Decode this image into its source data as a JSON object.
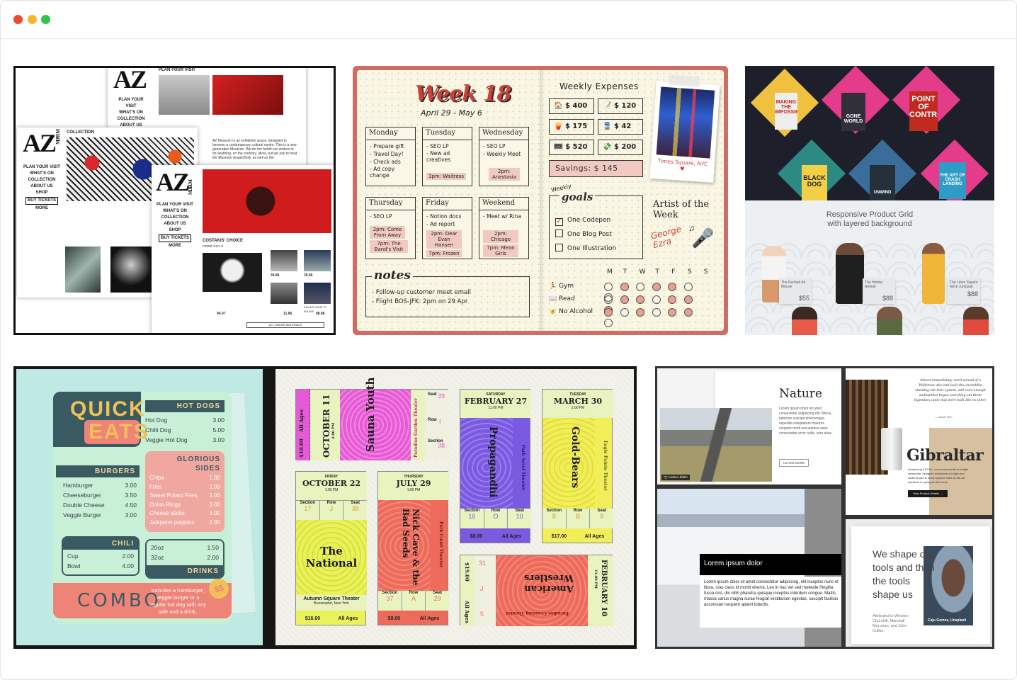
{
  "window": {
    "dot_colors": [
      "#ee4a30",
      "#f6b52c",
      "#2fc44a"
    ]
  },
  "az": {
    "logo": "AZ",
    "logo_sub": "MUSEUM",
    "nav": [
      "PLAN YOUR VISIT",
      "WHAT'S ON",
      "COLLECTION",
      "ABOUT US",
      "SHOP",
      "BUY TICKETS",
      "MORE"
    ],
    "top_heading": "PLAN YOUR VISIT",
    "collection_label": "COLLECTION",
    "body": "AZ Museum is an exhibition space, designed to become a contemporary cultural centre. This is a new generation Museum. We do not forbid our visitors to do anything, on the contrary, allow, but we ask to treat the Museum respectfully, as well as the",
    "choice_title": "COSTAKIS' CHOICE",
    "choice_sub": "FROM JULY 8",
    "prices": [
      "39.86",
      "39.86",
      "94.07",
      "11.86",
      "88.86"
    ],
    "caption": "SALVE PLAGUE TO ENLAND",
    "all_button": "ALL ONLINE MATERIALS"
  },
  "planner": {
    "title": "Week 18",
    "dates": "April 29 - May 6",
    "days": [
      {
        "name": "Monday",
        "items": [
          "- Prepare gift",
          "- Travel Day!",
          "- Check ads",
          "- Ad copy change"
        ],
        "highlight": ""
      },
      {
        "name": "Tuesday",
        "items": [
          "- SEO LP",
          "- New ad creatives"
        ],
        "highlight": "3pm: Waitress"
      },
      {
        "name": "Wednesday",
        "items": [
          "- SEO LP",
          "- Weekly Meet"
        ],
        "highlight": "2pm: Anastasia"
      },
      {
        "name": "Thursday",
        "items": [
          "- SEO LP"
        ],
        "highlight": "2pm: Come From Away",
        "highlight2": "7pm: The Band's Visit"
      },
      {
        "name": "Friday",
        "items": [
          "- Notion docs",
          "- Ad report"
        ],
        "highlight": "2pm: Dear Evan Hansen",
        "highlight2": "7pm: Frozen"
      },
      {
        "name": "Weekend",
        "items": [
          "- Meet w/ Rina"
        ],
        "highlight": "2pm: Chicago",
        "highlight2": "7pm: Mean Girls"
      }
    ],
    "notes_title": "notes",
    "notes": [
      "- Follow-up customer meet email",
      "- Flight BOS-JFK: 2pm on 29 Apr"
    ],
    "expenses_title": "Weekly Expenses",
    "expenses": [
      {
        "icon": "🏠",
        "amount": "$ 400"
      },
      {
        "icon": "📝",
        "amount": "$ 120"
      },
      {
        "icon": "🍟",
        "amount": "$ 175"
      },
      {
        "icon": "🚆",
        "amount": "$ 42"
      },
      {
        "icon": "🎟",
        "amount": "$ 520"
      },
      {
        "icon": "💸",
        "amount": "$ 200"
      }
    ],
    "savings": "Savings: $ 145",
    "photo_caption": "Times Square, NYC ♥",
    "goals_label_top": "Weekly",
    "goals_label": "goals",
    "goals": [
      {
        "text": "One Codepen",
        "checked": true
      },
      {
        "text": "One Blog Post",
        "checked": false
      },
      {
        "text": "One Illustration",
        "checked": false
      }
    ],
    "artist_title": "Artist of the Week",
    "artist_name": "George Ezra",
    "week_letters": [
      "M",
      "T",
      "W",
      "T",
      "F",
      "S",
      "S"
    ],
    "habits": [
      {
        "icon": "🏃",
        "name": "Gym",
        "filled": [
          false,
          true,
          false,
          true,
          true,
          false,
          false
        ]
      },
      {
        "icon": "📖",
        "name": "Read",
        "filled": [
          false,
          true,
          true,
          false,
          true,
          true,
          true
        ]
      },
      {
        "icon": "🍺",
        "name": "No Alcohol",
        "filled": [
          true,
          false,
          true,
          false,
          true,
          true,
          false
        ]
      }
    ]
  },
  "products": {
    "heading": "Responsive Product Grid",
    "subheading": "with layered background",
    "books": [
      "MAKING THE IMPOSSIBLE",
      "GONE WORLD",
      "POINT OF CONTROL",
      "BLACK DOG",
      "UNWIND",
      "THE ART OF CRASH LANDING"
    ],
    "items": [
      {
        "name": "The Ruched Air Blouse",
        "price": "$55"
      },
      {
        "name": "The Hollow Anorak",
        "price": "$88"
      },
      {
        "name": "The Linen Square Neck Jumpsuit",
        "price": "$88"
      }
    ]
  },
  "menu": {
    "brand_1": "QUICK",
    "brand_2": "EATS",
    "sections": {
      "hotdogs": {
        "title": "HOT DOGS",
        "rows": [
          [
            "Hot Dog",
            "3.00"
          ],
          [
            "Chilli Dog",
            "5.00"
          ],
          [
            "Veggie Hot Dog",
            "3.00"
          ]
        ]
      },
      "burgers": {
        "title": "BURGERS",
        "rows": [
          [
            "Hamburger",
            "3.00"
          ],
          [
            "Cheeseburger",
            "3.50"
          ],
          [
            "Double Cheese",
            "4.50"
          ],
          [
            "Veggie Burger",
            "3.00"
          ]
        ]
      },
      "sides": {
        "title1": "GLORIOUS",
        "title2": "SIDES",
        "rows": [
          [
            "Chips",
            "1.00"
          ],
          [
            "Fries",
            "2.00"
          ],
          [
            "Sweet Potato Fries",
            "3.00"
          ],
          [
            "Onion Rings",
            "3.00"
          ],
          [
            "Cheese sticks",
            "3.00"
          ],
          [
            "Jalepeno poppers",
            "2.00"
          ]
        ]
      },
      "chili": {
        "title": "CHILI",
        "rows": [
          [
            "Cup",
            "2.00"
          ],
          [
            "Bowl",
            "4.00"
          ]
        ]
      },
      "drinks": {
        "title": "DRINKS",
        "rows": [
          [
            "20oz",
            "1.50"
          ],
          [
            "32oz",
            "2.00"
          ]
        ]
      }
    },
    "combo": "COMBO",
    "combo_desc": "Includes a hamburger, veggie burger or a regular hot dog with any side and a drink.",
    "combo_price": "$5"
  },
  "tickets": [
    {
      "day": "MONDAY",
      "date": "OCTOBER 11",
      "time": "4:00 PM",
      "name": "Sauna Youth",
      "venue": "Paradise Garden Theater",
      "price": "$10.00",
      "ages": "All Ages",
      "section": "39",
      "row": "I",
      "seat": "38"
    },
    {
      "day": "SATURDAY",
      "date": "FEBRUARY 27",
      "time": "11:00 PM",
      "name": "Propagandhi",
      "venue": "Park Accel Theater",
      "price": "$8.00",
      "ages": "All Ages",
      "section": "16",
      "row": "O",
      "seat": "10"
    },
    {
      "day": "TUESDAY",
      "date": "MARCH 30",
      "time": "1:00 PM",
      "name": "Gold-Bears",
      "venue": "Eagle Pointe Theater",
      "price": "$17.00",
      "ages": "All Ages",
      "section": "8",
      "row": "B",
      "seat": "9"
    },
    {
      "day": "FRIDAY",
      "date": "OCTOBER 22",
      "time": "1:00 PM",
      "name": "The National",
      "venue": "Autumn Square Theater",
      "city": "Buzzenport, New York",
      "price": "$16.00",
      "ages": "All Ages",
      "section": "17",
      "row": "J",
      "seat": "38"
    },
    {
      "day": "THURSDAY",
      "date": "JULY 29",
      "time": "1:00 PM",
      "name": "Nick Cave & the Bad Seeds",
      "venue": "Park Court Theater",
      "price": "$9.00",
      "ages": "All Ages",
      "section": "37",
      "row": "A",
      "seat": "29"
    },
    {
      "day": "WEDNESDAY",
      "date": "FEBRUARY 10",
      "time": "11:00 PM",
      "name": "American Wrestlers",
      "venue": "Paradise Crossing Theater",
      "price": "$19.00",
      "ages": "All Ages",
      "section": "31",
      "row": "J",
      "seat": "5"
    }
  ],
  "ticket_labels": {
    "section": "Section",
    "row": "Row",
    "seat": "Seat"
  },
  "editorial": {
    "nature_title": "Nature",
    "nature_body": "Lorem ipsum dolor sit amet consectetur adipiscing elit. Minus, laborum suscipit doloremque, expedita voluptatum maiores corporis modi accusamus esse consectetur error nulla, vero alias.",
    "nature_button": "LEARN MORE",
    "photo_credit": "Anders Jildén",
    "quote": "Almost immediately, word spread of a Wolfsman who had built this incredible standing tub bass system, and soon enough audiophiles began searching out these legendary units that were built like no other.",
    "quote_author": "— Jason Fish",
    "gibraltar_title": "Gibraltar",
    "gibraltar_body": "Introducing Z10 Ra, our most powerful and agile subwoofer, designed exclusively for high-end systems and to show superior state-of-the-art speakers in spring-to-fall rooms.",
    "gibraltar_button": "View Product Details →",
    "lorem_title": "Lorem ipsum dolor",
    "lorem_body": "Lorem ipsum dolor sit amet consectetur adipiscing, elit inceptos nunc et litora, cras class id morbi viverra. Leo in hac vel sed molestie fringilla fusce orci, dis nibh pharetra quisque inceptos interdum congue. Mattis massa varius magna curae feugiat vestibulum egestas, suscipit facilisis accumsan torquent aptent lobortis.",
    "shape_text": "We shape our tools and then the tools shape us",
    "shape_attr": "Attributed to Winston Churchill, Marshall McLuhan, and John Culkin.",
    "shape_credit": "Caju Gomes, Unsplash"
  }
}
